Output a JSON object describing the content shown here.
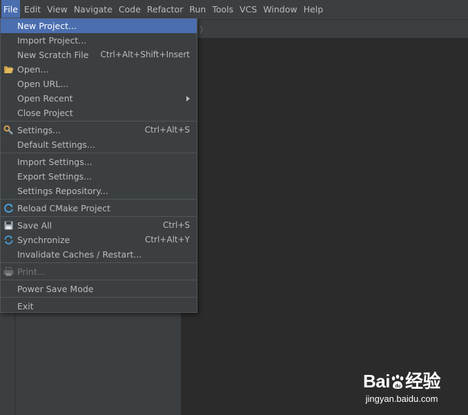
{
  "menubar": {
    "items": [
      {
        "label": "File",
        "active": true
      },
      {
        "label": "Edit"
      },
      {
        "label": "View"
      },
      {
        "label": "Navigate"
      },
      {
        "label": "Code"
      },
      {
        "label": "Refactor"
      },
      {
        "label": "Run"
      },
      {
        "label": "Tools"
      },
      {
        "label": "VCS"
      },
      {
        "label": "Window"
      },
      {
        "label": "Help"
      }
    ]
  },
  "editor": {
    "breadcrumb_chevron": "〉"
  },
  "file_menu": {
    "items": [
      {
        "label": "New Project...",
        "selected": true
      },
      {
        "label": "Import Project..."
      },
      {
        "label": "New Scratch File",
        "shortcut": "Ctrl+Alt+Shift+Insert"
      },
      {
        "label": "Open...",
        "icon": "folder-icon"
      },
      {
        "label": "Open URL..."
      },
      {
        "label": "Open Recent",
        "submenu": true
      },
      {
        "label": "Close Project"
      },
      {
        "label": "Settings...",
        "shortcut": "Ctrl+Alt+S",
        "icon": "wrench-icon"
      },
      {
        "label": "Default Settings..."
      },
      {
        "label": "Import Settings..."
      },
      {
        "label": "Export Settings..."
      },
      {
        "label": "Settings Repository..."
      },
      {
        "label": "Reload CMake Project",
        "icon": "reload-icon"
      },
      {
        "label": "Save All",
        "shortcut": "Ctrl+S",
        "icon": "save-icon"
      },
      {
        "label": "Synchronize",
        "shortcut": "Ctrl+Alt+Y",
        "icon": "sync-icon"
      },
      {
        "label": "Invalidate Caches / Restart..."
      },
      {
        "label": "Print...",
        "disabled": true,
        "icon": "printer-icon"
      },
      {
        "label": "Power Save Mode"
      },
      {
        "label": "Exit"
      }
    ]
  },
  "watermark": {
    "logo_text_a": "Bai",
    "logo_text_b": "经验",
    "paw_text": "du",
    "url": "jingyan.baidu.com"
  },
  "colors": {
    "menu_bg": "#3c3f41",
    "selection": "#4b6eaf",
    "editor_bg": "#2b2b2b",
    "text": "#bbbbbb"
  }
}
